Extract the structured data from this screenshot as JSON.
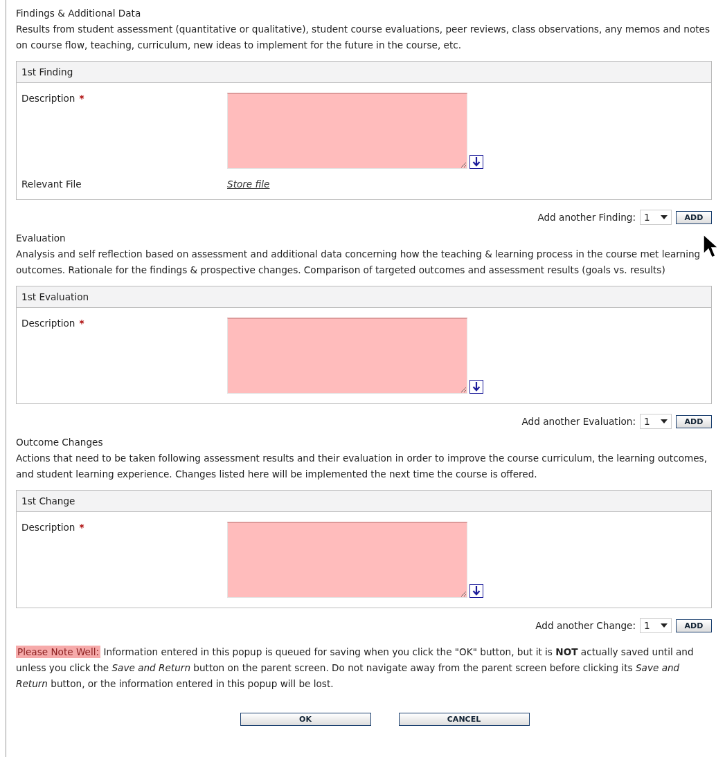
{
  "sections": [
    {
      "title": "Findings & Additional Data",
      "description": "Results from student assessment (quantitative or qualitative), student course evaluations, peer reviews, class observations, any memos and notes on course flow, teaching, curriculum, new ideas to implement for the future in the course, etc.",
      "card": {
        "header": "1st Finding",
        "rows": [
          {
            "kind": "textarea",
            "label": "Description",
            "required_mark": "*"
          },
          {
            "kind": "file",
            "label": "Relevant File",
            "link": "Store file"
          }
        ]
      },
      "add": {
        "label": "Add another Finding:",
        "value": "1",
        "button": "ADD"
      }
    },
    {
      "title": "Evaluation",
      "description": "Analysis and self reflection based on assessment and additional data concerning how the teaching & learning process in the course met learning outcomes. Rationale for the findings & prospective changes. Comparison of targeted outcomes and assessment results (goals vs. results)",
      "card": {
        "header": "1st Evaluation",
        "rows": [
          {
            "kind": "textarea",
            "label": "Description",
            "required_mark": "*"
          }
        ]
      },
      "add": {
        "label": "Add another Evaluation:",
        "value": "1",
        "button": "ADD"
      }
    },
    {
      "title": "Outcome Changes",
      "description": "Actions that need to be taken following assessment results and their evaluation in order to improve the course curriculum, the learning outcomes, and student learning experience. Changes listed here will be implemented the next time the course is offered.",
      "card": {
        "header": "1st Change",
        "rows": [
          {
            "kind": "textarea",
            "label": "Description",
            "required_mark": "*"
          }
        ]
      },
      "add": {
        "label": "Add another Change:",
        "value": "1",
        "button": "ADD"
      }
    }
  ],
  "note": {
    "label": "Please Note Well:",
    "text": "Information entered in this popup is queued for saving when you click the \"OK\" button, but it is **NOT** actually saved until and unless you click the *Save and Return* button on the parent screen. Do not navigate away from the parent screen before clicking its *Save and Return* button, or the information entered in this popup will be lost."
  },
  "buttons": [
    "OK",
    "CANCEL"
  ],
  "mouse_cursor": true
}
